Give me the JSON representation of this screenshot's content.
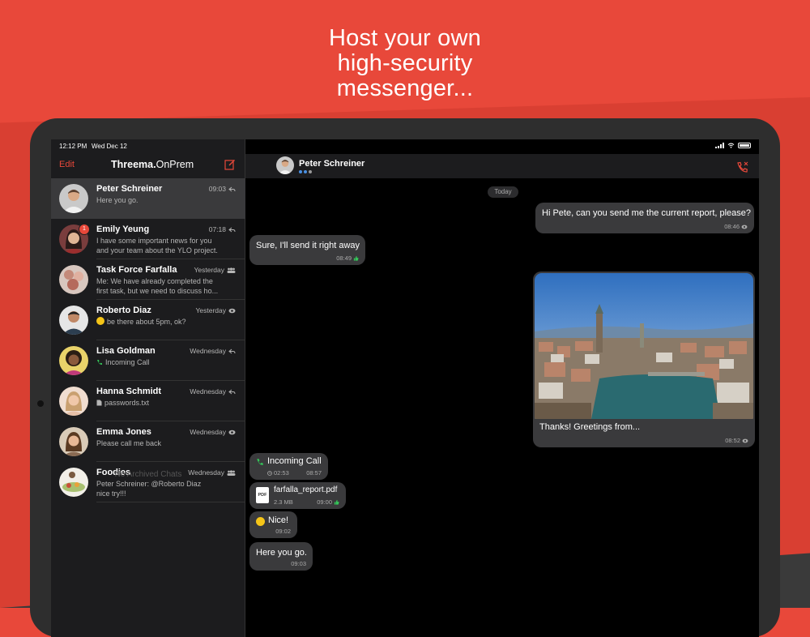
{
  "headline": {
    "line1": "Host your own",
    "line2": "high-security",
    "line3": "messenger..."
  },
  "statusbar": {
    "time": "12:12 PM",
    "date": "Wed Dec 12"
  },
  "sidebar": {
    "edit_label": "Edit",
    "brand_main": "Threema.",
    "brand_sub": "OnPrem",
    "archived_label": "No Archived Chats",
    "chats": [
      {
        "name": "Peter Schreiner",
        "time": "09:03",
        "status": "reply-icon",
        "preview1": "Here you go.",
        "preview2": ""
      },
      {
        "name": "Emily Yeung",
        "time": "07:18",
        "status": "reply-icon",
        "badge": "1",
        "preview1": "I have some important news for you",
        "preview2": "and your team about the YLO project."
      },
      {
        "name": "Task Force Farfalla",
        "time": "Yesterday",
        "status": "group-icon",
        "preview1": "Me: We have already completed the",
        "preview2": "first task, but we need to discuss ho..."
      },
      {
        "name": "Roberto Diaz",
        "time": "Yesterday",
        "status": "eye-icon",
        "preview1": "be there about 5pm, ok?",
        "preview2": ""
      },
      {
        "name": "Lisa Goldman",
        "time": "Wednesday",
        "status": "reply-icon",
        "preview1": "Incoming Call",
        "preview2": ""
      },
      {
        "name": "Hanna Schmidt",
        "time": "Wednesday",
        "status": "reply-icon",
        "preview1": "passwords.txt",
        "preview2": ""
      },
      {
        "name": "Emma Jones",
        "time": "Wednesday",
        "status": "eye-icon",
        "preview1": "Please call me back",
        "preview2": ""
      },
      {
        "name": "Foodies",
        "time": "Wednesday",
        "status": "group-icon",
        "preview1": "Peter Schreiner: @Roberto Diaz",
        "preview2": "nice try!!!"
      }
    ]
  },
  "conversation": {
    "contact_name": "Peter Schreiner",
    "date_separator": "Today",
    "messages": [
      {
        "text": "Hi Pete, can you send me the current report, please?",
        "time": "08:46"
      },
      {
        "text": "Sure, I'll send it right away",
        "time": "08:49"
      },
      {
        "text": "Thanks! Greetings from...",
        "time": "08:52"
      },
      {
        "text": "Incoming Call",
        "duration": "02:53",
        "time": "08:57"
      },
      {
        "text": "farfalla_report.pdf",
        "size": "2.3 MB",
        "time": "09:00",
        "file_type": "PDF"
      },
      {
        "text": "Nice!",
        "time": "09:02"
      },
      {
        "text": "Here you go.",
        "time": "09:03"
      }
    ]
  },
  "colors": {
    "accent": "#e8483a",
    "background": "#000000",
    "bubble": "#3a3a3c",
    "ack_green": "#34c759"
  }
}
